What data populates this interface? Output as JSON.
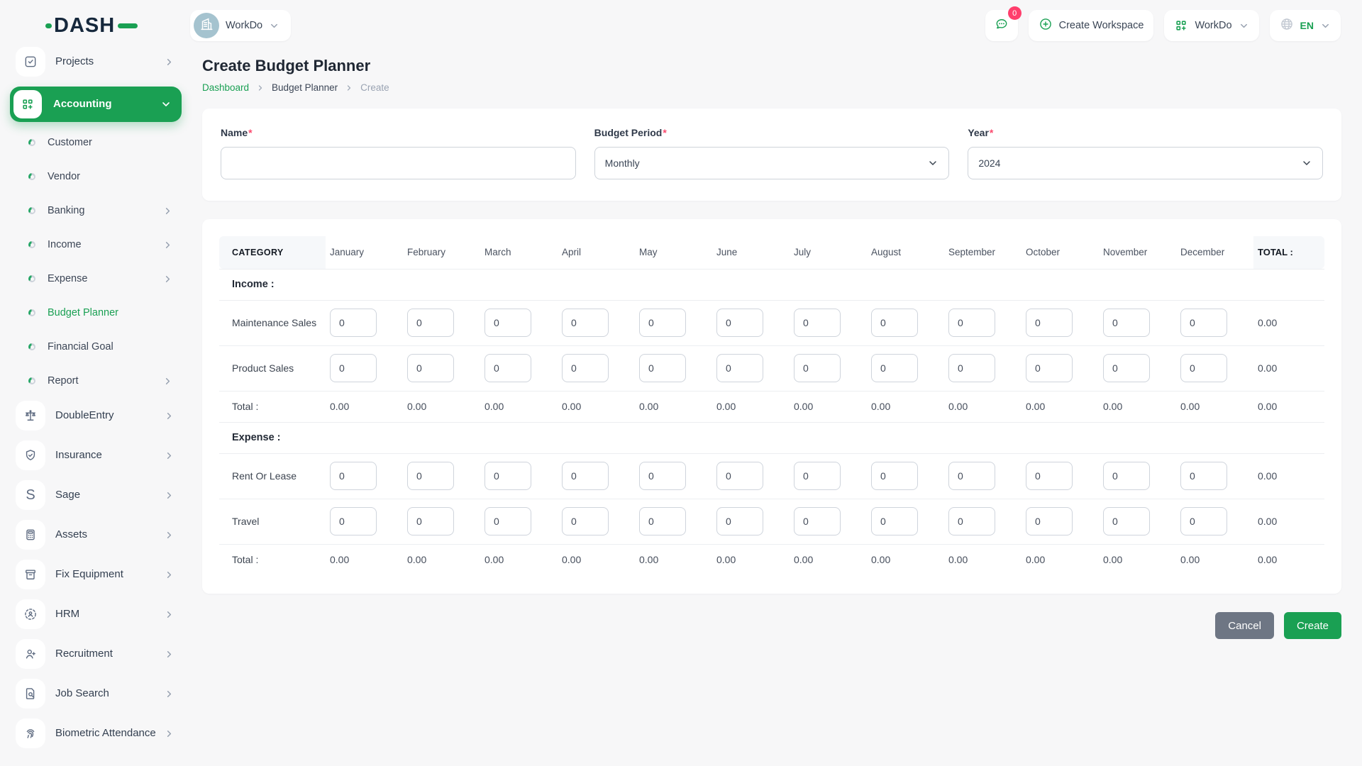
{
  "colors": {
    "accent_green": "#1aa053",
    "navy": "#16283c",
    "badge_pink": "#ff3e6c",
    "button_gray": "#6e7684"
  },
  "brand": {
    "logo_text": "DASH"
  },
  "topbar": {
    "workspace_selector": {
      "label": "WorkDo",
      "avatar_icon": "building-icon"
    },
    "messages": {
      "icon": "chat-icon",
      "badge": "0"
    },
    "create_workspace": {
      "icon": "plus-circle-icon",
      "label": "Create Workspace"
    },
    "workspace_menu": {
      "icon": "grid-plus-icon",
      "label": "WorkDo"
    },
    "language": {
      "icon": "globe-icon",
      "label": "EN"
    }
  },
  "sidebar": {
    "items": [
      {
        "type": "main",
        "label": "Projects",
        "icon": "checkbox-icon",
        "chevron": "right"
      },
      {
        "type": "main",
        "label": "Accounting",
        "icon": "grid-plus-icon",
        "chevron": "down",
        "active": true
      },
      {
        "type": "sub",
        "label": "Customer"
      },
      {
        "type": "sub",
        "label": "Vendor"
      },
      {
        "type": "sub",
        "label": "Banking",
        "chevron": "right"
      },
      {
        "type": "sub",
        "label": "Income",
        "chevron": "right"
      },
      {
        "type": "sub",
        "label": "Expense",
        "chevron": "right"
      },
      {
        "type": "sub",
        "label": "Budget Planner",
        "active": true
      },
      {
        "type": "sub",
        "label": "Financial Goal"
      },
      {
        "type": "sub",
        "label": "Report",
        "chevron": "right"
      },
      {
        "type": "main",
        "label": "DoubleEntry",
        "icon": "scales-icon",
        "chevron": "right"
      },
      {
        "type": "main",
        "label": "Insurance",
        "icon": "shield-check-icon",
        "chevron": "right"
      },
      {
        "type": "main",
        "label": "Sage",
        "icon": "sage-s-icon",
        "chevron": "right"
      },
      {
        "type": "main",
        "label": "Assets",
        "icon": "calculator-icon",
        "chevron": "right"
      },
      {
        "type": "main",
        "label": "Fix Equipment",
        "icon": "archive-box-icon",
        "chevron": "right"
      },
      {
        "type": "main",
        "label": "HRM",
        "icon": "hrm-people-icon",
        "chevron": "right"
      },
      {
        "type": "main",
        "label": "Recruitment",
        "icon": "user-plus-icon",
        "chevron": "right"
      },
      {
        "type": "main",
        "label": "Job Search",
        "icon": "file-search-icon",
        "chevron": "right"
      },
      {
        "type": "main",
        "label": "Biometric Attendance",
        "icon": "fingerprint-icon",
        "chevron": "right"
      }
    ]
  },
  "page": {
    "title": "Create Budget Planner",
    "breadcrumb": {
      "home": "Dashboard",
      "section": "Budget Planner",
      "current": "Create"
    }
  },
  "form": {
    "required_mark": "*",
    "name_field": {
      "label": "Name",
      "value": "",
      "placeholder": ""
    },
    "period_field": {
      "label": "Budget Period",
      "value": "Monthly"
    },
    "year_field": {
      "label": "Year",
      "value": "2024"
    }
  },
  "budget_table": {
    "category_header": "CATEGORY",
    "months": [
      "January",
      "February",
      "March",
      "April",
      "May",
      "June",
      "July",
      "August",
      "September",
      "October",
      "November",
      "December"
    ],
    "total_header": "TOTAL :",
    "sections": [
      {
        "title": "Income :",
        "rows": [
          {
            "label": "Maintenance Sales",
            "values": [
              "0",
              "0",
              "0",
              "0",
              "0",
              "0",
              "0",
              "0",
              "0",
              "0",
              "0",
              "0"
            ],
            "total": "0.00"
          },
          {
            "label": "Product Sales",
            "values": [
              "0",
              "0",
              "0",
              "0",
              "0",
              "0",
              "0",
              "0",
              "0",
              "0",
              "0",
              "0"
            ],
            "total": "0.00"
          }
        ],
        "total_row": {
          "label": "Total :",
          "values": [
            "0.00",
            "0.00",
            "0.00",
            "0.00",
            "0.00",
            "0.00",
            "0.00",
            "0.00",
            "0.00",
            "0.00",
            "0.00",
            "0.00"
          ],
          "total": "0.00"
        }
      },
      {
        "title": "Expense :",
        "rows": [
          {
            "label": "Rent Or Lease",
            "values": [
              "0",
              "0",
              "0",
              "0",
              "0",
              "0",
              "0",
              "0",
              "0",
              "0",
              "0",
              "0"
            ],
            "total": "0.00"
          },
          {
            "label": "Travel",
            "values": [
              "0",
              "0",
              "0",
              "0",
              "0",
              "0",
              "0",
              "0",
              "0",
              "0",
              "0",
              "0"
            ],
            "total": "0.00"
          }
        ],
        "total_row": {
          "label": "Total :",
          "values": [
            "0.00",
            "0.00",
            "0.00",
            "0.00",
            "0.00",
            "0.00",
            "0.00",
            "0.00",
            "0.00",
            "0.00",
            "0.00",
            "0.00"
          ],
          "total": "0.00"
        }
      }
    ]
  },
  "actions": {
    "cancel_label": "Cancel",
    "create_label": "Create"
  }
}
